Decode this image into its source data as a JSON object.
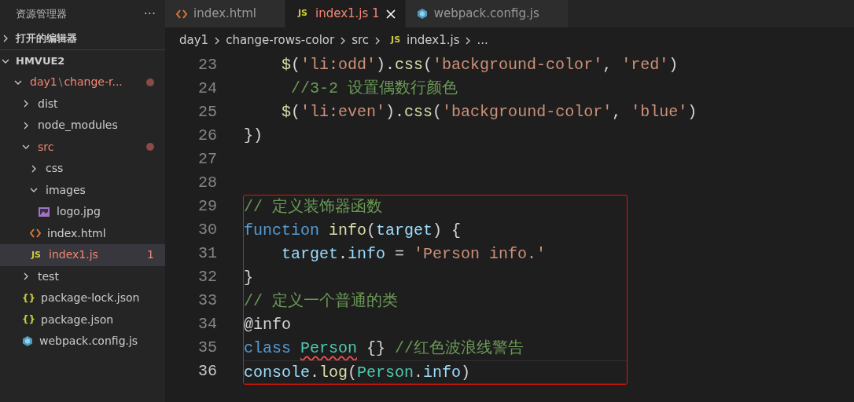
{
  "sidebar": {
    "title": "资源管理器",
    "more": "···",
    "sections": [
      {
        "label": "打开的编辑器",
        "expanded": false
      },
      {
        "label": "HMVUE2",
        "expanded": true
      }
    ],
    "tree": [
      {
        "label": "day1",
        "separator": "\\",
        "label_suffix": "change-r...",
        "kind": "folder",
        "expanded": true,
        "modified": true,
        "selected": false,
        "children": [
          {
            "label": "dist",
            "kind": "folder",
            "expanded": false,
            "modified": false,
            "selected": false
          },
          {
            "label": "node_modules",
            "kind": "folder",
            "expanded": false,
            "modified": false,
            "selected": false
          },
          {
            "label": "src",
            "kind": "folder",
            "expanded": true,
            "modified": true,
            "selected": false,
            "children": [
              {
                "label": "css",
                "kind": "folder",
                "expanded": false,
                "modified": false,
                "selected": false
              },
              {
                "label": "images",
                "kind": "folder",
                "expanded": true,
                "modified": false,
                "selected": false,
                "children": [
                  {
                    "label": "logo.jpg",
                    "kind": "image",
                    "modified": false,
                    "selected": false
                  }
                ]
              },
              {
                "label": "index.html",
                "kind": "html",
                "modified": false,
                "selected": false
              },
              {
                "label": "index1.js",
                "kind": "js",
                "glyph": "JS",
                "modified": true,
                "problems": "1",
                "selected": true
              }
            ]
          },
          {
            "label": "test",
            "kind": "folder",
            "expanded": false,
            "modified": false,
            "selected": false
          },
          {
            "label": "package-lock.json",
            "kind": "json",
            "glyph": "{}",
            "modified": false,
            "selected": false
          },
          {
            "label": "package.json",
            "kind": "json",
            "glyph": "{}",
            "modified": false,
            "selected": false
          },
          {
            "label": "webpack.config.js",
            "kind": "webpack",
            "modified": false,
            "selected": false
          }
        ]
      }
    ]
  },
  "tabs": [
    {
      "label": "index.html",
      "kind": "html",
      "selected": false,
      "modified": false
    },
    {
      "label": "index1.js",
      "kind": "js",
      "glyph": "JS",
      "problems": "1",
      "selected": true,
      "modified": true
    },
    {
      "label": "webpack.config.js",
      "kind": "webpack",
      "selected": false,
      "modified": false
    }
  ],
  "breadcrumbs": [
    {
      "label": "day1"
    },
    {
      "label": "change-rows-color"
    },
    {
      "label": "src"
    },
    {
      "label": "index1.js",
      "glyph": "JS"
    },
    {
      "label": "..."
    }
  ],
  "code": [
    {
      "number": "23",
      "current": false,
      "tokens": [
        {
          "t": "    $",
          "kind": "func"
        },
        {
          "t": "(",
          "kind": "plain"
        },
        {
          "t": "'li:odd'",
          "kind": "string"
        },
        {
          "t": ").",
          "kind": "plain"
        },
        {
          "t": "css",
          "kind": "func"
        },
        {
          "t": "(",
          "kind": "plain"
        },
        {
          "t": "'background-color'",
          "kind": "string"
        },
        {
          "t": ", ",
          "kind": "plain"
        },
        {
          "t": "'red'",
          "kind": "string"
        },
        {
          "t": ")",
          "kind": "plain"
        }
      ]
    },
    {
      "number": "24",
      "current": false,
      "tokens": [
        {
          "t": "     //3-2 设置偶数行颜色",
          "kind": "comment"
        }
      ]
    },
    {
      "number": "25",
      "current": false,
      "tokens": [
        {
          "t": "    $",
          "kind": "func"
        },
        {
          "t": "(",
          "kind": "plain"
        },
        {
          "t": "'li:even'",
          "kind": "string"
        },
        {
          "t": ").",
          "kind": "plain"
        },
        {
          "t": "css",
          "kind": "func"
        },
        {
          "t": "(",
          "kind": "plain"
        },
        {
          "t": "'background-color'",
          "kind": "string"
        },
        {
          "t": ", ",
          "kind": "plain"
        },
        {
          "t": "'blue'",
          "kind": "string"
        },
        {
          "t": ")",
          "kind": "plain"
        }
      ]
    },
    {
      "number": "26",
      "current": false,
      "tokens": [
        {
          "t": "})",
          "kind": "plain"
        }
      ]
    },
    {
      "number": "27",
      "current": false
    },
    {
      "number": "28",
      "current": false
    }
  ],
  "highlight_box": {
    "lines": [
      {
        "number": "29",
        "current": false,
        "tokens": [
          {
            "t": "// 定义装饰器函数",
            "kind": "comment"
          }
        ]
      },
      {
        "number": "30",
        "current": false,
        "tokens": [
          {
            "t": "function ",
            "kind": "keyword"
          },
          {
            "t": "info",
            "kind": "func"
          },
          {
            "t": "(",
            "kind": "plain"
          },
          {
            "t": "target",
            "kind": "var"
          },
          {
            "t": ") {",
            "kind": "plain"
          }
        ]
      },
      {
        "number": "31",
        "current": false,
        "tokens": [
          {
            "t": "    target",
            "kind": "var"
          },
          {
            "t": ".",
            "kind": "plain"
          },
          {
            "t": "info",
            "kind": "var"
          },
          {
            "t": " = ",
            "kind": "plain"
          },
          {
            "t": "'Person info.'",
            "kind": "string"
          }
        ]
      },
      {
        "number": "32",
        "current": false,
        "tokens": [
          {
            "t": "}",
            "kind": "plain"
          }
        ]
      },
      {
        "number": "33",
        "current": false,
        "tokens": [
          {
            "t": "// 定义一个普通的类",
            "kind": "comment"
          }
        ]
      },
      {
        "number": "34",
        "current": false,
        "tokens": [
          {
            "t": "@",
            "kind": "plain"
          },
          {
            "t": "info",
            "kind": "plain"
          }
        ]
      },
      {
        "number": "35",
        "current": false,
        "tokens": [
          {
            "t": "class ",
            "kind": "keyword"
          },
          {
            "t": "Person",
            "kind": "class",
            "error": true
          },
          {
            "t": " {} ",
            "kind": "plain"
          },
          {
            "t": "//红色波浪线警告",
            "kind": "comment"
          }
        ]
      },
      {
        "number": "36",
        "current": true,
        "tokens": [
          {
            "t": "console",
            "kind": "var"
          },
          {
            "t": ".",
            "kind": "plain"
          },
          {
            "t": "log",
            "kind": "func"
          },
          {
            "t": "(",
            "kind": "plain"
          },
          {
            "t": "Person",
            "kind": "class"
          },
          {
            "t": ".",
            "kind": "plain"
          },
          {
            "t": "info",
            "kind": "var"
          },
          {
            "t": ")",
            "kind": "plain"
          }
        ]
      }
    ]
  }
}
